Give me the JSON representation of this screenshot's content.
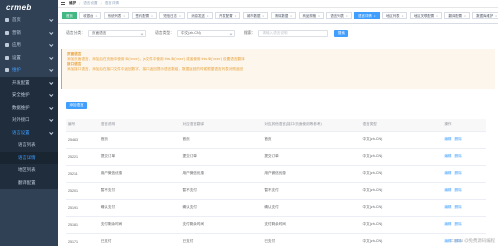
{
  "sidebar": {
    "logo": "crmeb",
    "items": [
      {
        "label": "首页",
        "level": 0,
        "state": ""
      },
      {
        "label": "营销",
        "level": 0,
        "state": ""
      },
      {
        "label": "应用",
        "level": 0,
        "state": ""
      },
      {
        "label": "设置",
        "level": 0,
        "state": ""
      },
      {
        "label": "维护",
        "level": 0,
        "state": "active"
      },
      {
        "label": "开发配置",
        "level": 1,
        "state": ""
      },
      {
        "label": "安全维护",
        "level": 1,
        "state": ""
      },
      {
        "label": "数据维护",
        "level": 1,
        "state": ""
      },
      {
        "label": "对外接口",
        "level": 1,
        "state": ""
      },
      {
        "label": "语言设置",
        "level": 1,
        "state": "active"
      },
      {
        "label": "语言列表",
        "level": 2,
        "state": ""
      },
      {
        "label": "语言详情",
        "level": 2,
        "state": "selected"
      },
      {
        "label": "地区列表",
        "level": 2,
        "state": ""
      },
      {
        "label": "翻译配置",
        "level": 2,
        "state": ""
      }
    ]
  },
  "breadcrumb": [
    "维护",
    "语言设置",
    "语言详情"
  ],
  "tags": [
    {
      "label": "首页",
      "style": "active"
    },
    {
      "label": "收银台",
      "style": ""
    },
    {
      "label": "系统列表",
      "style": ""
    },
    {
      "label": "签约配置",
      "style": ""
    },
    {
      "label": "短信日志",
      "style": ""
    },
    {
      "label": "消息发送",
      "style": ""
    },
    {
      "label": "开发配置",
      "style": ""
    },
    {
      "label": "城市数据",
      "style": ""
    },
    {
      "label": "清除数据",
      "style": ""
    },
    {
      "label": "商品规格",
      "style": ""
    },
    {
      "label": "语言列表",
      "style": ""
    },
    {
      "label": "语言详情",
      "style": "highlight"
    },
    {
      "label": "地区列表",
      "style": ""
    },
    {
      "label": "地区关联配置",
      "style": ""
    },
    {
      "label": "翻译配置",
      "style": ""
    },
    {
      "label": "数据库维护",
      "style": ""
    }
  ],
  "search": {
    "type_label": "语言分类：",
    "type_value": "页面语言",
    "lang_label": "语言类型：",
    "lang_value": "中文(zh-CN)",
    "keyword_label": "搜索：",
    "keyword_placeholder": "请输入语言说明",
    "query_button": "搜索"
  },
  "tip": {
    "title1": "页面语言",
    "line1": "添加页面语言，添加后在页面中使用 $t('xxxx')，js文件中使用 this.$t('xxxx') 或者使用 this.$t('xxxx') 设置语言翻译",
    "title2": "接口语言",
    "line2": "添加接口语言，添加后在接口文件中返回数字，接口返回提示语言数组，数据返回的时候根据语言列表对照返回"
  },
  "add_button": "添加语言",
  "table": {
    "headers": [
      "编号",
      "语言说明",
      "对应语言翻译",
      "对应其他语言(接口/页面使用等参考)",
      "语言类型",
      "操作"
    ],
    "rows": [
      [
        "25463",
        "首页",
        "首页",
        "首页",
        "中文(zh-CN)"
      ],
      [
        "25221",
        "提交订单",
        "提交订单",
        "提交订单",
        "中文(zh-CN)"
      ],
      [
        "25211",
        "用户微信优惠",
        "用户微信优惠",
        "用户微信优惠",
        "中文(zh-CN)"
      ],
      [
        "25201",
        "暂不支付",
        "暂不支付",
        "暂不支付",
        "中文(zh-CN)"
      ],
      [
        "25191",
        "确认支付",
        "确认支付",
        "确认支付",
        "中文(zh-CN)"
      ],
      [
        "25181",
        "支付剩余时间",
        "支付剩余时间",
        "支付剩余时间",
        "中文(zh-CN)"
      ],
      [
        "25171",
        "已支付",
        "已支付",
        "已支付",
        "中文(zh-CN)"
      ]
    ],
    "edit_label": "编辑",
    "delete_label": "删除"
  },
  "watermark": "CSDN @免费源码编程"
}
